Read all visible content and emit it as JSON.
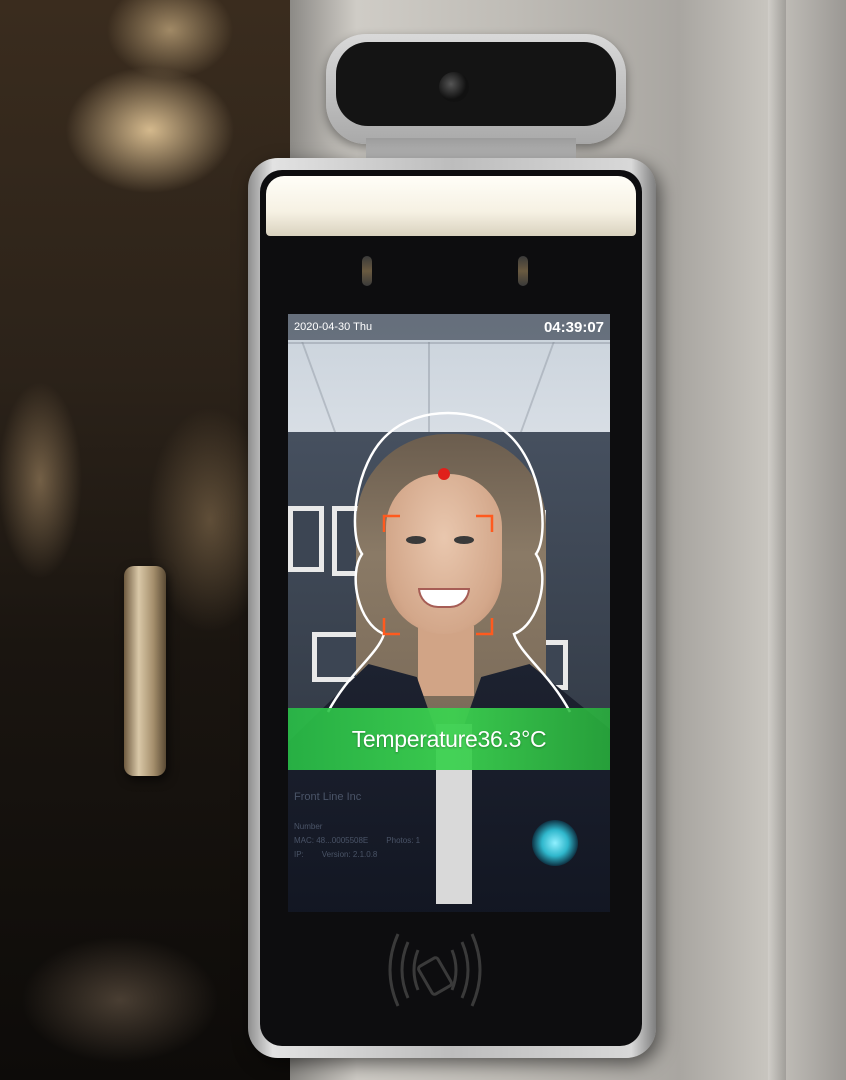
{
  "screen": {
    "date": "2020-04-30 Thu",
    "time": "04:39:07",
    "temperature_label": "Temperature36.3°C",
    "info": {
      "company": "Front Line Inc",
      "number_label": "Number",
      "mac_label": "MAC: 48...0005508E",
      "photos_label": "Photos: 1",
      "ip_label": "IP:",
      "version_label": "Version: 2.1.0.8"
    }
  },
  "colors": {
    "banner": "#33c24f",
    "face_frame": "#ff5a1e",
    "forehead_dot": "#e0201b",
    "outline": "#ffffff"
  },
  "icons": [
    "camera-icon",
    "fingerprint-icon",
    "rfid-icon"
  ]
}
